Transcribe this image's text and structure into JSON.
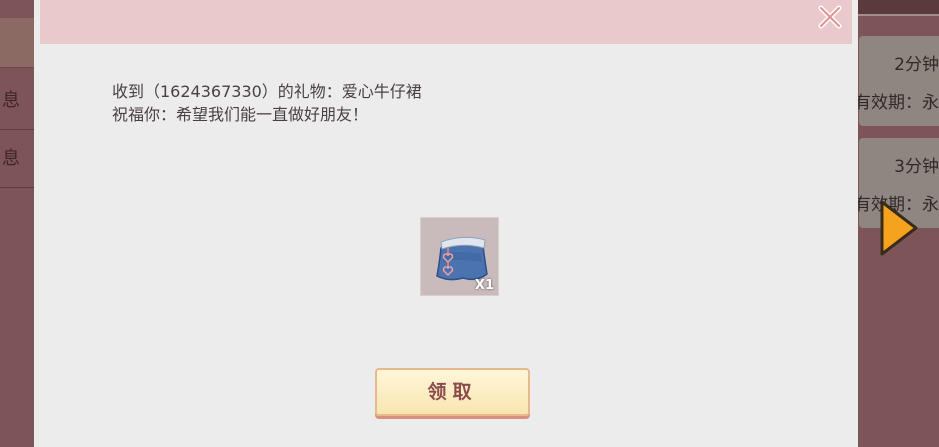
{
  "background": {
    "left_rows": [
      "息",
      "息"
    ],
    "right_cards": [
      {
        "time": "2分钟",
        "validity": "有效期：永"
      },
      {
        "time": "3分钟",
        "validity": "有效期：永"
      }
    ]
  },
  "dialog": {
    "message_line1": "收到（1624367330）的礼物：爱心牛仔裙",
    "message_line2": "祝福你：希望我们能一直做好朋友！",
    "gift": {
      "icon": "denim-skirt-heart-icon",
      "count": "X1"
    },
    "claim_label": "领取",
    "close_icon": "close-icon"
  },
  "colors": {
    "header": "#e9c9cb",
    "dialog_bg": "#ececec",
    "button_border": "#e9b98d",
    "button_text": "#8c4c4c",
    "arrow": "#f5a21e"
  }
}
